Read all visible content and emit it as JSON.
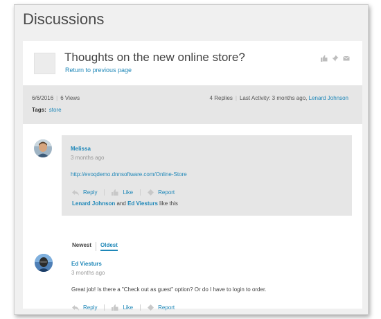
{
  "page": {
    "title": "Discussions"
  },
  "topic": {
    "title": "Thoughts on the new online store?",
    "return_link": "Return to previous page",
    "date": "6/6/2016",
    "views": "6 Views",
    "replies": "4 Replies",
    "last_activity_prefix": "Last Activity: 3 months ago,",
    "last_activity_user": "Lenard Johnson",
    "tags_label": "Tags:",
    "tag": "store"
  },
  "first_post": {
    "author": "Melissa",
    "time": "3 months ago",
    "link": "http://evoqdemo.dnnsoftware.com/Online-Store",
    "reply_label": "Reply",
    "like_label": "Like",
    "report_label": "Report",
    "liker_1": "Lenard Johnson",
    "and_text": "and",
    "liker_2": "Ed Viesturs",
    "like_suffix": "like this"
  },
  "sort": {
    "newest": "Newest",
    "oldest": "Oldest"
  },
  "reply_post": {
    "author": "Ed Viesturs",
    "time": "3 months ago",
    "text": "Great job! Is there a \"Check out as guest\" option? Or do I have to login to order.",
    "reply_label": "Reply",
    "like_label": "Like",
    "report_label": "Report"
  },
  "colors": {
    "link": "#1e87b8",
    "panel": "#e6e6e6",
    "background": "#f0f0f0"
  },
  "icons": [
    "thumbs-up-icon",
    "pin-icon",
    "envelope-icon",
    "reply-arrow-icon",
    "thumb-icon",
    "flag-icon"
  ]
}
